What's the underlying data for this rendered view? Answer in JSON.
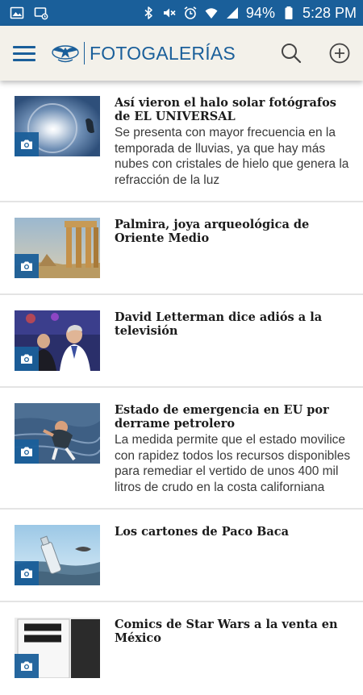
{
  "status_bar": {
    "battery": "94%",
    "time": "5:28 PM",
    "icons_left": [
      "gallery-icon",
      "screen-icon"
    ],
    "icons_right": [
      "bluetooth-icon",
      "mute-icon",
      "alarm-icon",
      "wifi-icon",
      "signal-icon",
      "battery-icon"
    ]
  },
  "app_bar": {
    "title": "FOTOGALERÍAS",
    "icons": [
      "menu-icon",
      "eagle-logo-icon",
      "search-icon",
      "add-icon"
    ]
  },
  "colors": {
    "brand": "#1a5f9a",
    "app_bar_bg": "#f3f1ea",
    "text": "#1b1b1b"
  },
  "items": [
    {
      "title": "Así vieron el halo solar fotógrafos de EL UNIVERSAL",
      "summary": "Se presenta con mayor frecuencia en la temporada de lluvias, ya que hay más nubes con cristales de hielo que genera la refracción de la luz"
    },
    {
      "title": "Palmira, joya arqueológica de Oriente Medio",
      "summary": ""
    },
    {
      "title": "David Letterman dice adiós a la televisión",
      "summary": ""
    },
    {
      "title": "Estado de emergencia en EU por derrame petrolero",
      "summary": "La medida permite que el estado movilice con rapidez todos los recursos disponibles para remediar el vertido de unos 400 mil litros de crudo en la costa californiana"
    },
    {
      "title": "Los cartones de Paco Baca",
      "summary": ""
    },
    {
      "title": "Comics de Star Wars a la venta en México",
      "summary": ""
    }
  ]
}
